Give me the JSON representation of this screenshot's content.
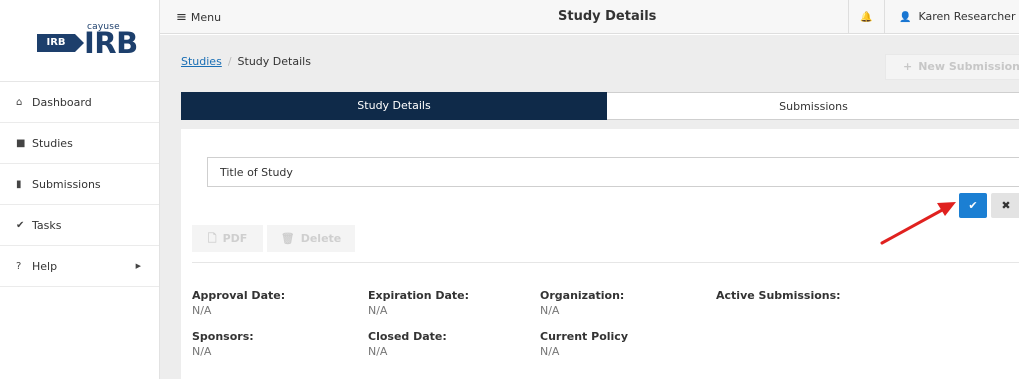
{
  "logo": {
    "badge": "IRB",
    "small": "cayuse",
    "big": "IRB"
  },
  "sidebar": {
    "items": [
      {
        "icon": "home-icon",
        "glyph": "⌂",
        "label": "Dashboard"
      },
      {
        "icon": "folder-icon",
        "glyph": "■",
        "label": "Studies"
      },
      {
        "icon": "file-icon",
        "glyph": "▮",
        "label": "Submissions"
      },
      {
        "icon": "check-icon",
        "glyph": "✔",
        "label": "Tasks"
      },
      {
        "icon": "question-icon",
        "glyph": "?",
        "label": "Help",
        "caret": "▶"
      }
    ]
  },
  "topbar": {
    "menu_glyph": "≡",
    "menu_label": "Menu",
    "heading": "Study Details",
    "bell_glyph": "🔔",
    "user_glyph": "👤",
    "user_name": "Karen Researcher"
  },
  "breadcrumb": {
    "studies": "Studies",
    "sep": "/",
    "current": "Study Details"
  },
  "new_submission": {
    "glyph": "+",
    "label": "New Submission"
  },
  "tabs": [
    {
      "label": "Study Details",
      "active": true
    },
    {
      "label": "Submissions",
      "active": false
    }
  ],
  "form": {
    "title_value": "Title of Study",
    "save_glyph": "✔",
    "cancel_glyph": "✖"
  },
  "actions": {
    "pdf_glyph": "🗋",
    "pdf_label": "PDF",
    "delete_glyph": "🗑",
    "delete_label": "Delete"
  },
  "details": {
    "approval_date": {
      "label": "Approval Date:",
      "value": "N/A"
    },
    "expiration_date": {
      "label": "Expiration Date:",
      "value": "N/A"
    },
    "organization": {
      "label": "Organization:",
      "value": "N/A"
    },
    "active_submissions": {
      "label": "Active Submissions:",
      "value": ""
    },
    "sponsors": {
      "label": "Sponsors:",
      "value": "N/A"
    },
    "closed_date": {
      "label": "Closed Date:",
      "value": "N/A"
    },
    "current_policy": {
      "label": "Current Policy",
      "value": "N/A"
    }
  },
  "colors": {
    "brand": "#1d3f6c",
    "active_tab": "#0f2a49",
    "save_button": "#1b7fd3",
    "arrow": "#e0211f"
  }
}
